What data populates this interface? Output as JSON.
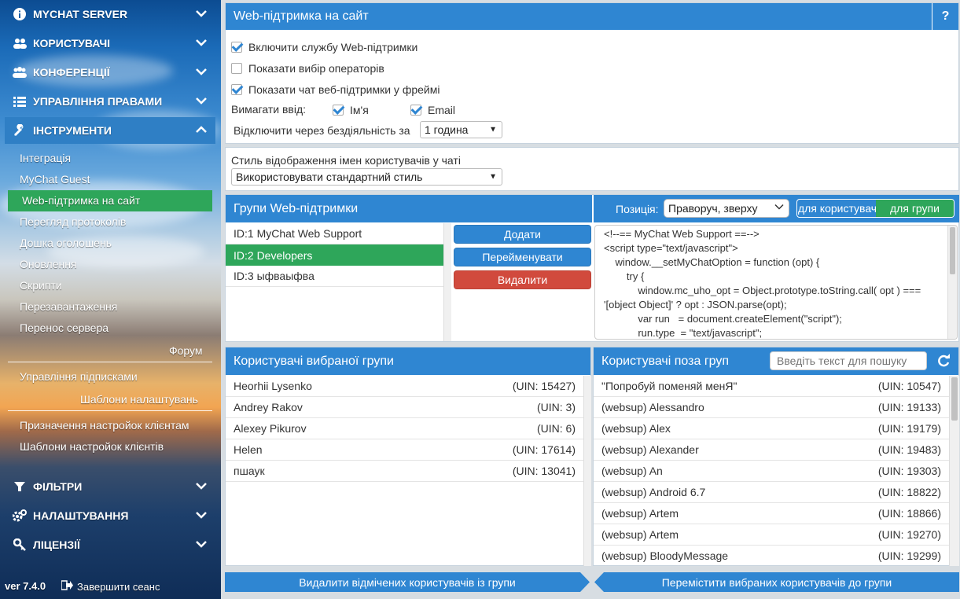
{
  "sidebar": {
    "sections_top": [
      {
        "label": "MYCHAT SERVER",
        "icon": "info-icon"
      },
      {
        "label": "КОРИСТУВАЧІ",
        "icon": "users-icon"
      },
      {
        "label": "КОНФЕРЕНЦІЇ",
        "icon": "conference-icon"
      },
      {
        "label": "УПРАВЛІННЯ ПРАВАМИ",
        "icon": "list-icon"
      },
      {
        "label": "ІНСТРУМЕНТИ",
        "icon": "wrench-icon"
      }
    ],
    "tools_items": [
      "Інтеграція",
      "MyChat Guest",
      "Web-підтримка на сайт",
      "Перегляд протоколів",
      "Дошка оголошень",
      "Оновлення",
      "Скрипти",
      "Перезавантаження",
      "Перенос сервера"
    ],
    "forum_label": "Форум",
    "forum_items": [
      "Управління підписками"
    ],
    "templates_label": "Шаблони налаштувань",
    "templates_items": [
      "Призначення настройок клієнтам",
      "Шаблони настройок клієнтів"
    ],
    "sections_bottom": [
      {
        "label": "ФІЛЬТРИ",
        "icon": "filter-icon"
      },
      {
        "label": "НАЛАШТУВАННЯ",
        "icon": "cogs-icon"
      },
      {
        "label": "ЛІЦЕНЗІЇ",
        "icon": "key-icon"
      }
    ],
    "version": "ver 7.4.0",
    "logout": "Завершити сеанс"
  },
  "web_support": {
    "title": "Web-підтримка на сайт",
    "help": "?",
    "enable_label": "Включити службу Web-підтримки",
    "enable_checked": true,
    "show_operators_label": "Показати вибір операторів",
    "show_operators_checked": false,
    "show_frame_label": "Показати чат веб-підтримки у фреймі",
    "show_frame_checked": true,
    "require_label": "Вимагати ввід:",
    "require_name_label": "Ім'я",
    "require_email_label": "Email",
    "idle_label": "Відключити через бездіяльність за",
    "idle_value": "1 година"
  },
  "style": {
    "label": "Стиль відображення імен користувачів у чаті",
    "value": "Використовувати стандартний стиль"
  },
  "groups": {
    "title": "Групи Web-підтримки",
    "position_label": "Позиція:",
    "position_value": "Праворуч, зверху",
    "toggle_user": "для користувача",
    "toggle_group": "для групи",
    "items": [
      "ID:1 MyChat Web Support",
      "ID:2 Developers",
      "ID:3 ыфваыфва"
    ],
    "add": "Додати",
    "rename": "Перейменувати",
    "delete": "Видалити",
    "code_lines": [
      "<!--== MyChat Web Support ==-->",
      "<script type=\"text/javascript\">",
      "    window.__setMyChatOption = function (opt) {",
      "        try {",
      "            window.mc_uho_opt = Object.prototype.toString.call( opt ) ===",
      "'[object Object]' ? opt : JSON.parse(opt);",
      "            var run   = document.createElement(\"script\");",
      "            run.type  = \"text/javascript\";"
    ]
  },
  "group_users": {
    "title": "Користувачі вибраної групи",
    "rows": [
      {
        "name": "Heorhii Lysenko",
        "uin": "(UIN: 15427)"
      },
      {
        "name": "Andrey Rakov",
        "uin": "(UIN: 3)"
      },
      {
        "name": "Alexey Pikurov",
        "uin": "(UIN: 6)"
      },
      {
        "name": "Helen",
        "uin": "(UIN: 17614)"
      },
      {
        "name": "пшаук",
        "uin": "(UIN: 13041)"
      }
    ]
  },
  "other_users": {
    "title": "Користувачі поза груп",
    "search_placeholder": "Введіть текст для пошуку",
    "rows": [
      {
        "name": "\"Попробуй поменяй менЯ\"",
        "uin": "(UIN: 10547)"
      },
      {
        "name": "(websup) Alessandro",
        "uin": "(UIN: 19133)"
      },
      {
        "name": "(websup) Alex",
        "uin": "(UIN: 19179)"
      },
      {
        "name": "(websup) Alexander",
        "uin": "(UIN: 19483)"
      },
      {
        "name": "(websup) An",
        "uin": "(UIN: 19303)"
      },
      {
        "name": "(websup) Android 6.7",
        "uin": "(UIN: 18822)"
      },
      {
        "name": "(websup) Artem",
        "uin": "(UIN: 18866)"
      },
      {
        "name": "(websup) Artem",
        "uin": "(UIN: 19270)"
      },
      {
        "name": "(websup) BloodyMessage",
        "uin": "(UIN: 19299)"
      }
    ]
  },
  "footer": {
    "remove_btn": "Видалити відмічених користувачів із групи",
    "move_btn": "Перемістити вибраних користувачів до групи"
  },
  "colors": {
    "accent": "#2f86d2",
    "green": "#2ea65a",
    "red": "#d14a3d"
  }
}
